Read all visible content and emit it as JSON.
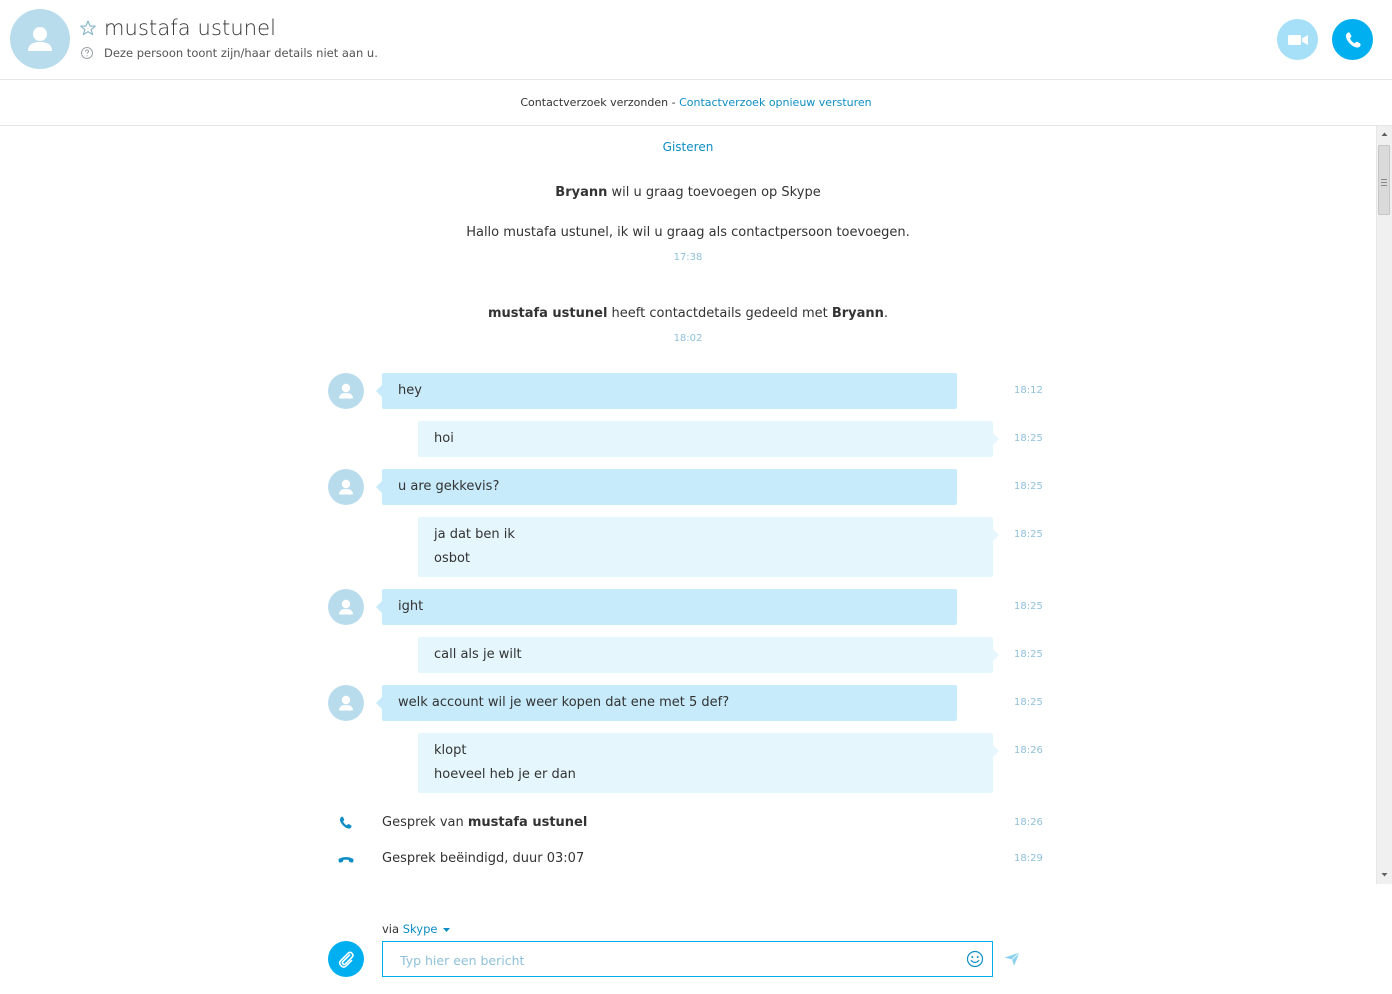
{
  "header": {
    "contact_name": "mustafa ustunel",
    "privacy_note": "Deze persoon toont zijn/haar details niet aan u."
  },
  "request_bar": {
    "sent_text": "Contactverzoek verzonden - ",
    "resend_link": "Contactverzoek opnieuw versturen"
  },
  "system": {
    "date_divider": "Gisteren",
    "request_name": "Bryann",
    "request_text": " wil u graag toevoegen op Skype",
    "greeting": "Hallo mustafa ustunel, ik wil u graag als contactpersoon toevoegen.",
    "greeting_time": "17:38",
    "shared_from": "mustafa ustunel",
    "shared_text": " heeft contactdetails gedeeld met ",
    "shared_to": "Bryann",
    "shared_period": ".",
    "shared_time": "18:02"
  },
  "messages": [
    {
      "direction": "in",
      "lines": [
        "hey"
      ],
      "time": "18:12"
    },
    {
      "direction": "out",
      "lines": [
        "hoi"
      ],
      "time": "18:25"
    },
    {
      "direction": "in",
      "lines": [
        "u are gekkevis?"
      ],
      "time": "18:25"
    },
    {
      "direction": "out",
      "lines": [
        "ja dat ben ik",
        "osbot"
      ],
      "time": "18:25"
    },
    {
      "direction": "in",
      "lines": [
        "ight"
      ],
      "time": "18:25"
    },
    {
      "direction": "out",
      "lines": [
        "call als je wilt"
      ],
      "time": "18:25"
    },
    {
      "direction": "in",
      "lines": [
        "welk account wil je weer kopen dat ene met 5 def?"
      ],
      "time": "18:25"
    },
    {
      "direction": "out",
      "lines": [
        "klopt",
        "hoeveel heb je er dan"
      ],
      "time": "18:26"
    }
  ],
  "calls": {
    "incoming_prefix": "Gesprek van ",
    "incoming_name": "mustafa ustunel",
    "incoming_time": "18:26",
    "ended_text": "Gesprek beëindigd, duur 03:07",
    "ended_time": "18:29"
  },
  "composer": {
    "via_prefix": "via ",
    "via_service": "Skype",
    "placeholder": "Typ hier een bericht"
  },
  "colors": {
    "accent": "#00aff0",
    "link": "#0e8ec4",
    "incoming_bubble": "#c7ebfa",
    "outgoing_bubble": "#e5f6fd",
    "avatar": "#b9dcec",
    "timestamp": "#8fc1da"
  }
}
